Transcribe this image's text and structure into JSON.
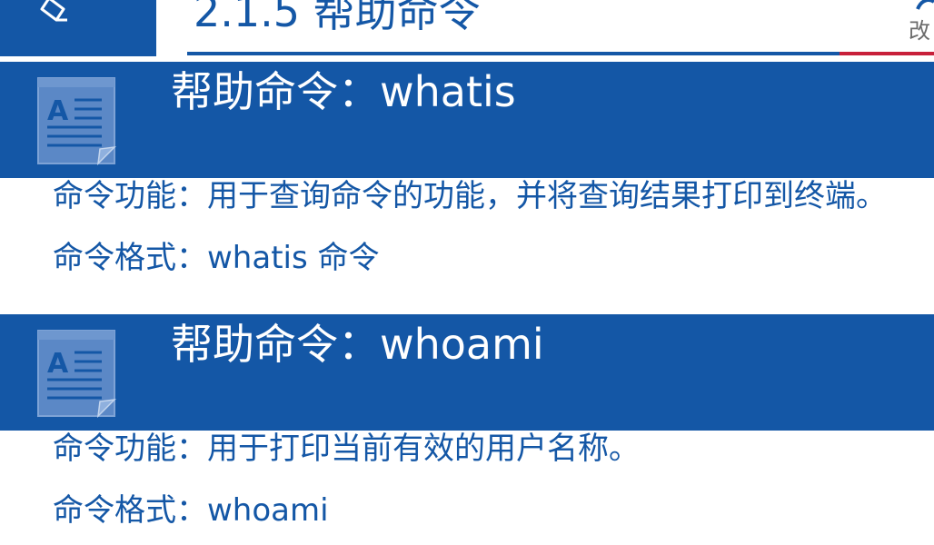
{
  "header": {
    "title": "2.1.5 帮助命令",
    "logo_fragment": "改"
  },
  "sections": [
    {
      "title": "帮助命令：whatis",
      "function_line": "命令功能：用于查询命令的功能，并将查询结果打印到终端。",
      "format_line": "命令格式：whatis 命令"
    },
    {
      "title": "帮助命令：whoami",
      "function_line": "命令功能：用于打印当前有效的用户名称。",
      "format_line": "命令格式：whoami"
    }
  ],
  "colors": {
    "brand_blue": "#1457a6",
    "accent_red": "#c8203a",
    "icon_fill": "#5b88c6"
  },
  "icons": [
    "pencil-icon",
    "document-icon"
  ]
}
